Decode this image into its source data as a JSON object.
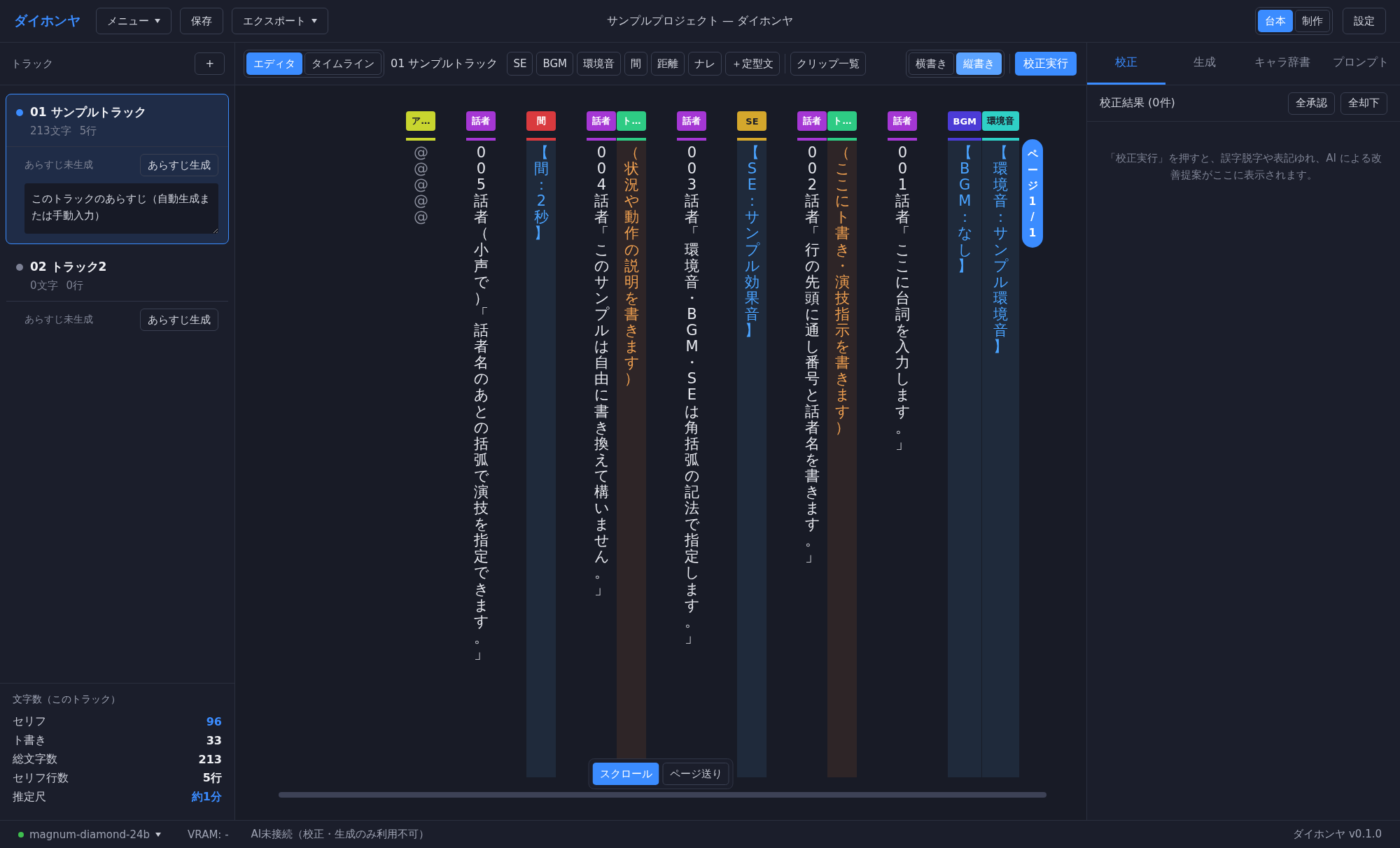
{
  "header": {
    "logo": "ダイホンヤ",
    "buttons": [
      {
        "label": "メニュー",
        "dropdown": true
      },
      {
        "label": "保存",
        "dropdown": false
      },
      {
        "label": "エクスポート",
        "dropdown": true
      }
    ],
    "title": "サンプルプロジェクト — ダイホンヤ",
    "modes": [
      {
        "label": "台本",
        "selected": true
      },
      {
        "label": "制作",
        "selected": false
      }
    ],
    "settings": "設定"
  },
  "sidebar": {
    "title": "トラック",
    "add_button": "+",
    "tracks": [
      {
        "name": "01 サンプルトラック",
        "chars": "213文字",
        "lines": "5行",
        "selected": true,
        "color": "#3b8cff",
        "synopsis_status": "あらすじ未生成",
        "synopsis_button": "あらすじ生成",
        "synopsis_placeholder": "このトラックのあらすじ（自動生成または手動入力）"
      },
      {
        "name": "02 トラック2",
        "chars": "0文字",
        "lines": "0行",
        "selected": false,
        "color": "#7c8094",
        "synopsis_status": "あらすじ未生成",
        "synopsis_button": "あらすじ生成"
      }
    ],
    "stats": {
      "title": "文字数（このトラック）",
      "rows": [
        {
          "label": "セリフ",
          "value": "96",
          "highlight": true
        },
        {
          "label": "ト書き",
          "value": "33",
          "highlight": false
        },
        {
          "label": "総文字数",
          "value": "213",
          "highlight": false
        },
        {
          "label": "セリフ行数",
          "value": "5行",
          "highlight": false
        },
        {
          "label": "推定尺",
          "value": "約1分",
          "highlight": true
        }
      ]
    }
  },
  "editor": {
    "views": [
      {
        "label": "エディタ",
        "selected": true
      },
      {
        "label": "タイムライン",
        "selected": false
      }
    ],
    "track_name": "01 サンプルトラック",
    "insert_buttons": [
      "SE",
      "BGM",
      "環境音",
      "間",
      "距離",
      "ナレ",
      "＋定型文"
    ],
    "clip_list": "クリップ一覧",
    "orientations": [
      {
        "label": "横書き",
        "selected": false
      },
      {
        "label": "縦書き",
        "selected": true
      }
    ],
    "proof_button": "校正実行",
    "lines": [
      {
        "lanes": [
          {
            "tag": "ア…",
            "color": "#c8d52f",
            "kind": "note",
            "text": "@@@@@"
          }
        ]
      },
      {
        "lanes": [
          {
            "tag": "話者",
            "color": "#a537d4",
            "kind": "dialogue",
            "text": "005 話者（小声で）「話者名のあとの括弧で演技を指定できます。」"
          }
        ]
      },
      {
        "lanes": [
          {
            "tag": "間",
            "color": "#d93a3e",
            "kind": "sound",
            "text": "【間：2秒】"
          }
        ]
      },
      {
        "lanes": [
          {
            "tag": "話者",
            "color": "#a537d4",
            "kind": "dialogue",
            "text": "004 話者「このサンプルは自由に書き換えて構いません。」"
          },
          {
            "tag": "ト…",
            "color": "#2ecb84",
            "kind": "direction",
            "text": "（状況や動作の説明を書きます）"
          }
        ]
      },
      {
        "lanes": [
          {
            "tag": "話者",
            "color": "#a537d4",
            "kind": "dialogue",
            "text": "003 話者「環境音・BGM・SE は角括弧の記法で指定します。」"
          }
        ]
      },
      {
        "lanes": [
          {
            "tag": "SE",
            "color": "#d4a72c",
            "kind": "sound",
            "text": "【SE：サンプル効果音】"
          }
        ]
      },
      {
        "lanes": [
          {
            "tag": "話者",
            "color": "#a537d4",
            "kind": "dialogue",
            "text": "002 話者「行の先頭に通し番号と話者名を書きます。」"
          },
          {
            "tag": "ト…",
            "color": "#2ecb84",
            "kind": "direction",
            "text": "（ここにト書き・演技指示を書きます）"
          }
        ]
      },
      {
        "lanes": [
          {
            "tag": "話者",
            "color": "#a537d4",
            "kind": "dialogue",
            "text": "001 話者「ここに台詞を入力します。」"
          }
        ]
      },
      {
        "lanes": [
          {
            "tag": "BGM",
            "color": "#4b3bd6",
            "kind": "sound",
            "text": "【BGM：なし】"
          },
          {
            "tag": "環境音",
            "color": "#2fd0c6",
            "kind": "sound",
            "text": "【環境音：サンプル環境音】"
          }
        ]
      }
    ],
    "page_indicator": "ページ 1 / 1",
    "scroll_modes": [
      {
        "label": "スクロール",
        "selected": true
      },
      {
        "label": "ページ送り",
        "selected": false
      }
    ]
  },
  "panel": {
    "tabs": [
      {
        "label": "校正",
        "selected": true
      },
      {
        "label": "生成",
        "selected": false
      },
      {
        "label": "キャラ辞書",
        "selected": false
      },
      {
        "label": "プロンプト",
        "selected": false
      }
    ],
    "results_title": "校正結果 (0件)",
    "buttons": [
      "全承認",
      "全却下"
    ],
    "empty_message": "「校正実行」を押すと、誤字脱字や表記ゆれ、AI による改善提案がここに表示されます。"
  },
  "status_bar": {
    "model": "magnum-diamond-24b",
    "vram": "VRAM: -",
    "ai_status": "AI未接続（校正・生成のみ利用不可）",
    "version": "ダイホンヤ v0.1.0"
  }
}
